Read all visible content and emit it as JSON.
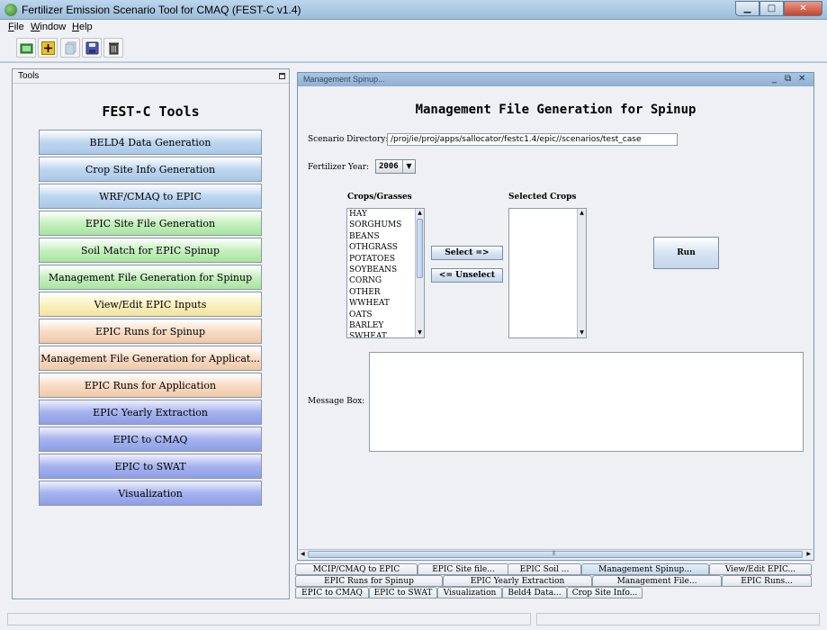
{
  "window": {
    "title": "Fertilizer Emission Scenario Tool for CMAQ (FEST-C v1.4)",
    "controls": {
      "minimize": "▁",
      "maximize": "□",
      "close": "✕"
    }
  },
  "menubar": {
    "items": [
      "File",
      "Window",
      "Help"
    ]
  },
  "toolbar": {
    "buttons": [
      {
        "name": "open-icon",
        "color": "#3a9a3a"
      },
      {
        "name": "add-icon",
        "color": "#f0c020"
      },
      {
        "name": "copy-icon",
        "color": "#c8d4e4"
      },
      {
        "name": "save-icon",
        "color": "#4a5ab0"
      },
      {
        "name": "trash-icon",
        "color": "#555555"
      }
    ]
  },
  "tools": {
    "header": "Tools",
    "title": "FEST-C Tools",
    "buttons": [
      {
        "label": "BELD4 Data Generation",
        "color": "blue"
      },
      {
        "label": "Crop Site Info Generation",
        "color": "blue"
      },
      {
        "label": "WRF/CMAQ to EPIC",
        "color": "blue"
      },
      {
        "label": "EPIC Site File Generation",
        "color": "green"
      },
      {
        "label": "Soil Match for EPIC Spinup",
        "color": "green"
      },
      {
        "label": "Management File Generation for Spinup",
        "color": "green"
      },
      {
        "label": "View/Edit EPIC Inputs",
        "color": "yellow"
      },
      {
        "label": "EPIC Runs for Spinup",
        "color": "orange"
      },
      {
        "label": "Management File Generation for Applicat...",
        "color": "orange"
      },
      {
        "label": "EPIC Runs for Application",
        "color": "orange"
      },
      {
        "label": "EPIC Yearly Extraction",
        "color": "purple"
      },
      {
        "label": "EPIC to CMAQ",
        "color": "purple"
      },
      {
        "label": "EPIC to SWAT",
        "color": "purple"
      },
      {
        "label": "Visualization",
        "color": "purple"
      }
    ]
  },
  "frame": {
    "title": "Management Spinup...",
    "controls": {
      "minimize": "_",
      "restore": "⧉",
      "close": "✕"
    },
    "heading": "Management File Generation for Spinup",
    "scenario_label": "Scenario Directory:",
    "scenario_value": "/proj/ie/proj/apps/sallocator/festc1.4/epic//scenarios/test_case",
    "year_label": "Fertilizer Year:",
    "year_value": "2006",
    "crops_label": "Crops/Grasses",
    "selected_label": "Selected Crops",
    "crops": [
      "HAY",
      "SORGHUMS",
      "BEANS",
      "OTHGRASS",
      "POTATOES",
      "SOYBEANS",
      "CORNG",
      "OTHER",
      "WWHEAT",
      "OATS",
      "BARLEY",
      "SWHEAT"
    ],
    "selected_crops": [],
    "select_button": "Select =>",
    "unselect_button": "<= Unselect",
    "run_button": "Run",
    "message_label": "Message Box:",
    "message_value": ""
  },
  "tabs": {
    "row1": [
      "MCIP/CMAQ to EPIC",
      "EPIC Site file...",
      "EPIC Soil ...",
      "Management Spinup...",
      "View/Edit EPIC..."
    ],
    "row2": [
      "EPIC Runs for Spinup",
      "EPIC Yearly Extraction",
      "Management File...",
      "EPIC Runs..."
    ],
    "row3": [
      "EPIC to CMAQ",
      "EPIC to SWAT",
      "Visualization",
      "Beld4 Data...",
      "Crop Site Info..."
    ],
    "selected": "Management Spinup..."
  }
}
